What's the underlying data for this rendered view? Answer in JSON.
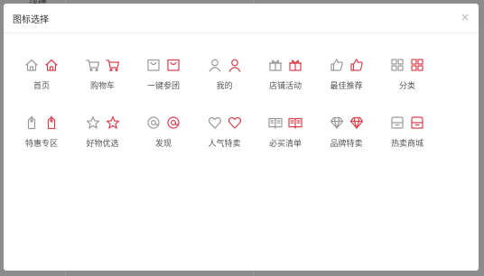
{
  "background": {
    "hint": "详情"
  },
  "dialog": {
    "title": "图标选择",
    "close_glyph": "×"
  },
  "colors": {
    "gray_icon": "#9a9a9a",
    "red_icon": "#d9414f"
  },
  "icons": [
    {
      "label": "首页",
      "icon": "home-icon"
    },
    {
      "label": "购物车",
      "icon": "cart-icon"
    },
    {
      "label": "一键参团",
      "icon": "bag-icon"
    },
    {
      "label": "我的",
      "icon": "user-icon"
    },
    {
      "label": "店铺活动",
      "icon": "gift-icon"
    },
    {
      "label": "最佳推荐",
      "icon": "thumbs-up-icon"
    },
    {
      "label": "分类",
      "icon": "grid-icon"
    },
    {
      "label": "特惠专区",
      "icon": "tag-icon"
    },
    {
      "label": "好物优选",
      "icon": "star-icon"
    },
    {
      "label": "发现",
      "icon": "at-icon"
    },
    {
      "label": "人气特卖",
      "icon": "heart-icon"
    },
    {
      "label": "必买清单",
      "icon": "book-icon"
    },
    {
      "label": "品牌特卖",
      "icon": "diamond-icon"
    },
    {
      "label": "热卖商城",
      "icon": "store-icon"
    }
  ]
}
